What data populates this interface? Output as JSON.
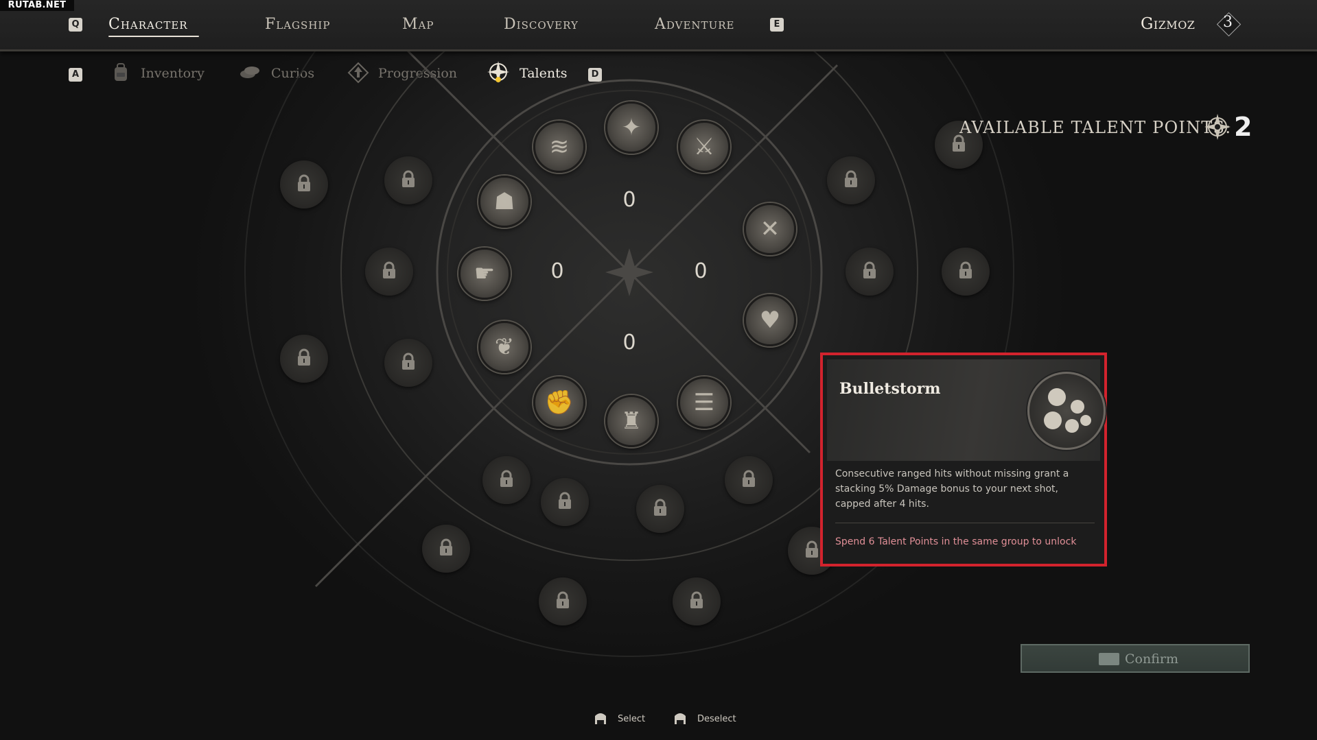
{
  "watermark": "RUTAB.NET",
  "top_nav": {
    "left_key": "Q",
    "right_key": "E",
    "tabs": [
      "Character",
      "Flagship",
      "Map",
      "Discovery",
      "Adventure"
    ],
    "active_tab": "Character",
    "player_name": "Gizmoz",
    "player_level": "3"
  },
  "sub_nav": {
    "left_key": "A",
    "right_key": "D",
    "tabs": [
      "Inventory",
      "Curios",
      "Progression",
      "Talents"
    ],
    "active_tab": "Talents"
  },
  "talent_points": {
    "label": "AVAILABLE TALENT POINTS:",
    "value": "2"
  },
  "wheel": {
    "group_counters": {
      "top": "0",
      "left": "0",
      "right": "0",
      "bottom": "0"
    }
  },
  "tooltip": {
    "title": "Bulletstorm",
    "description": "Consecutive ranged hits without missing grant a stacking 5% Damage bonus to your next shot, capped after 4 hits.",
    "requirement": "Spend 6 Talent Points in the same group to unlock",
    "highlight_color": "#d2232d"
  },
  "confirm_button": {
    "label": "Confirm"
  },
  "footer": {
    "select_label": "Select",
    "deselect_label": "Deselect"
  }
}
